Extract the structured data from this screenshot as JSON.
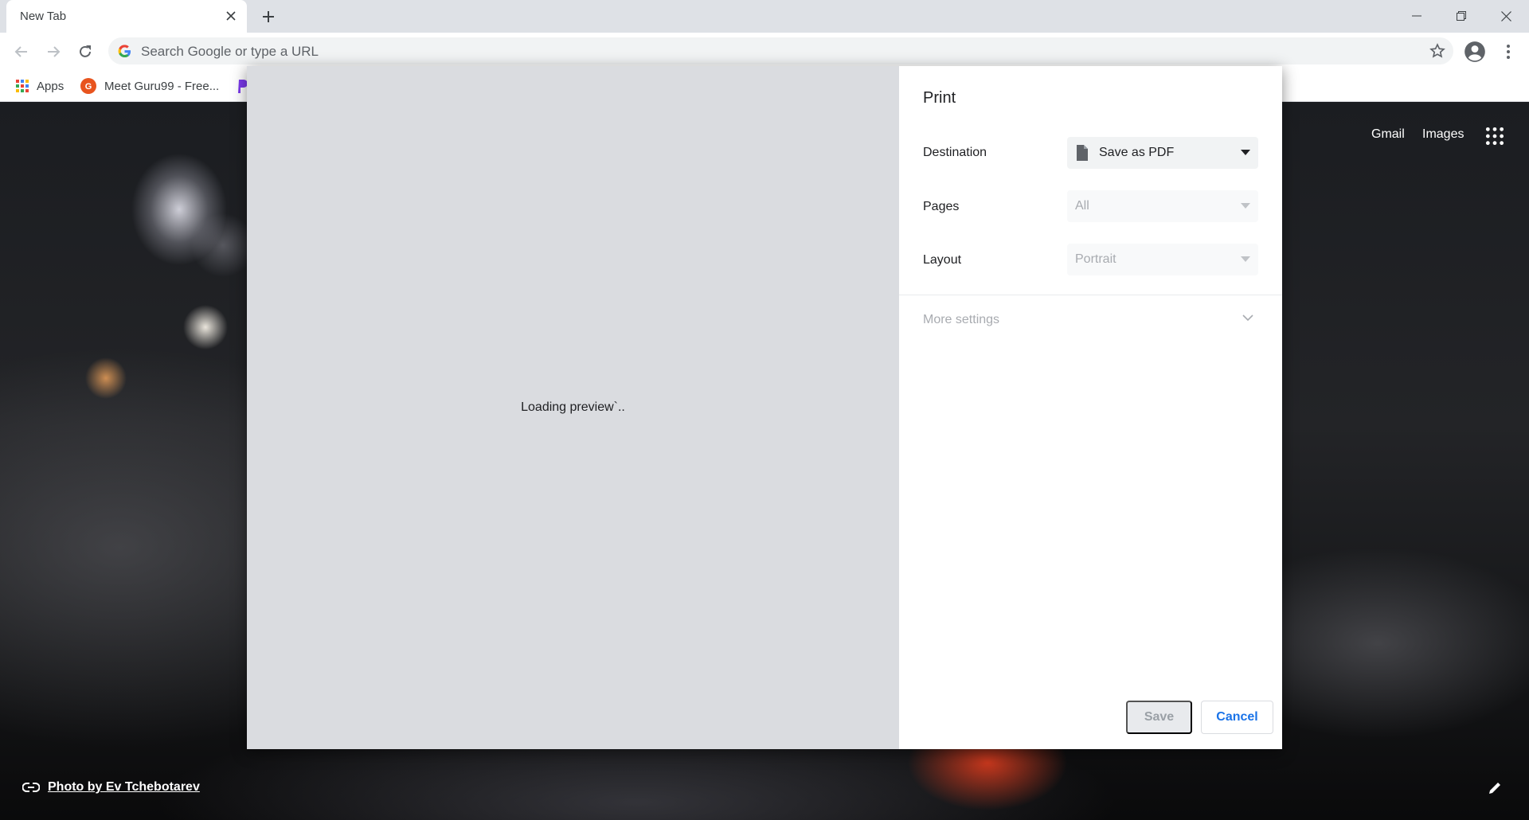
{
  "tab": {
    "title": "New Tab"
  },
  "omnibox": {
    "placeholder": "Search Google or type a URL"
  },
  "bookmarks": [
    {
      "label": "Apps"
    },
    {
      "label": "Meet Guru99 - Free..."
    }
  ],
  "ntp": {
    "gmail": "Gmail",
    "images": "Images",
    "photo_credit": "Photo by Ev Tchebotarev"
  },
  "print": {
    "title": "Print",
    "preview_status": "Loading preview`..",
    "destination": {
      "label": "Destination",
      "value": "Save as PDF"
    },
    "pages": {
      "label": "Pages",
      "value": "All"
    },
    "layout": {
      "label": "Layout",
      "value": "Portrait"
    },
    "more_settings": "More settings",
    "save_label": "Save",
    "cancel_label": "Cancel"
  },
  "colors": {
    "accent": "#1a73e8",
    "preview_bg": "#dadce0",
    "chrome_bg": "#dee1e6"
  },
  "icons": [
    "close-icon",
    "plus-icon",
    "minimize-icon",
    "restore-icon",
    "back-icon",
    "forward-icon",
    "reload-icon",
    "google-g-icon",
    "star-icon",
    "account-icon",
    "kebab-menu-icon",
    "apps-grid-icon",
    "guru99-icon",
    "document-icon",
    "chevron-down-icon",
    "link-icon",
    "pencil-icon"
  ]
}
